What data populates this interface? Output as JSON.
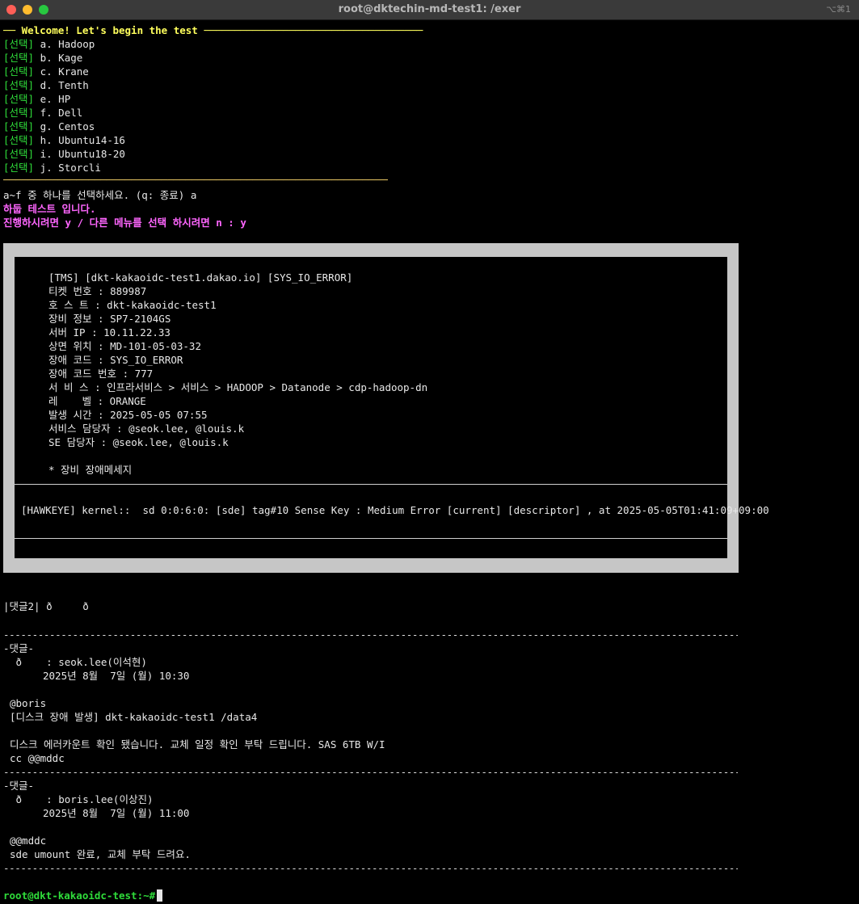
{
  "window": {
    "title": "root@dktechin-md-test1: /exer",
    "shortcut": "⌥⌘1"
  },
  "menu": {
    "welcome": "── Welcome! Let's begin the test ────────────────────────────────────",
    "tag": "[선택]",
    "items": [
      "a. Hadoop",
      "b. Kage",
      "c. Krane",
      "d. Tenth",
      "e. HP",
      "f. Dell",
      "g. Centos",
      "h. Ubuntu14-16",
      "i. Ubuntu18-20",
      "j. Storcli"
    ],
    "rule": "──────────────────────────────────────────────────────────────────────────"
  },
  "prompt_select": "a~f 중 하나를 선택하세요. (q: 종료) a",
  "hadoop_notice": "하둡 테스트 입니다.",
  "proceed_prompt": "진행하시려면 y / 다른 메뉴를 선택 하시려면 n : y",
  "ticket": {
    "header": "[TMS] [dkt-kakaoidc-test1.dakao.io] [SYS_IO_ERROR]",
    "lines": [
      "티켓 번호 : 889987",
      "호 스 트 : dkt-kakaoidc-test1",
      "장비 정보 : SP7-2104GS",
      "서버 IP : 10.11.22.33",
      "상면 위치 : MD-101-05-03-32",
      "장애 코드 : SYS_IO_ERROR",
      "장애 코드 번호 : 777",
      "서 비 스 : 인프라서비스 > 서비스 > HADOOP > Datanode > cdp-hadoop-dn",
      "레    벨 : ORANGE",
      "발생 시간 : 2025-05-05 07:55",
      "서비스 담당자 : @seok.lee, @louis.k",
      "SE 담당자 : @seok.lee, @louis.k"
    ],
    "message_title": "* 장비 장애메세지",
    "message": "[HAWKEYE] kernel::  sd 0:0:6:0: [sde] tag#10 Sense Key : Medium Error [current] [descriptor] , at 2025-05-05T01:41:09+09:00"
  },
  "comments_header": "|댓글2| ð     ð",
  "dash_rule": "------------------------------------------------------------------------------------------------------------------------------------------",
  "comments": [
    {
      "label": "-댓글-",
      "author": " ð    : seok.lee(이석현)",
      "date": "2025년 8월  7일 (월) 10:30",
      "body": [
        "@boris",
        "[디스크 장애 발생] dkt-kakaoidc-test1 /data4",
        "",
        "디스크 에러카운트 확인 됐습니다. 교체 일정 확인 부탁 드립니다. SAS 6TB W/I",
        "cc @@mddc"
      ]
    },
    {
      "label": "-댓글-",
      "author": " ð    : boris.lee(이상진)",
      "date": "2025년 8월  7일 (월) 11:00",
      "body": [
        "@@mddc",
        "sde umount 완료, 교체 부탁 드려요."
      ]
    }
  ],
  "shell_prompt": "root@dkt-kakaoidc-test:~#"
}
